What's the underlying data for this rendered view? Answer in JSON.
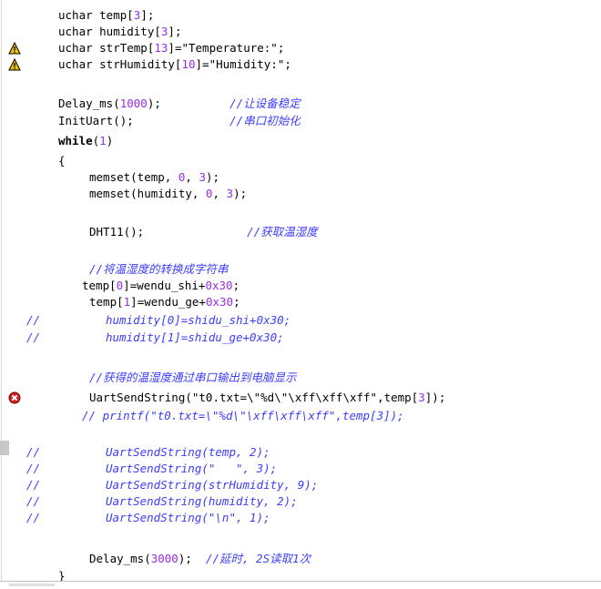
{
  "editor": {
    "lines": [
      {
        "indent": 64,
        "segments": [
          {
            "t": "uchar temp[",
            "c": "plain"
          },
          {
            "t": "3",
            "c": "num"
          },
          {
            "t": "];",
            "c": "plain"
          }
        ]
      },
      {
        "indent": 64,
        "segments": [
          {
            "t": "uchar humidity[",
            "c": "plain"
          },
          {
            "t": "3",
            "c": "num"
          },
          {
            "t": "];",
            "c": "plain"
          }
        ]
      },
      {
        "indent": 64,
        "marker": "warning",
        "segments": [
          {
            "t": "uchar strTemp[",
            "c": "plain"
          },
          {
            "t": "13",
            "c": "num"
          },
          {
            "t": "]=\"Temperature:\";",
            "c": "plain"
          }
        ]
      },
      {
        "indent": 64,
        "marker": "warning",
        "segments": [
          {
            "t": "uchar strHumidity[",
            "c": "plain"
          },
          {
            "t": "10",
            "c": "num"
          },
          {
            "t": "]=\"Humidity:\";",
            "c": "plain"
          }
        ]
      },
      {
        "indent": 64,
        "segments": []
      },
      {
        "indent": 64,
        "segments": [
          {
            "t": "Delay_ms(",
            "c": "plain"
          },
          {
            "t": "1000",
            "c": "num"
          },
          {
            "t": ");          ",
            "c": "plain"
          },
          {
            "t": "//让设备稳定",
            "c": "cm"
          }
        ]
      },
      {
        "indent": 64,
        "segments": [
          {
            "t": "InitUart();              ",
            "c": "plain"
          },
          {
            "t": "//串口初始化",
            "c": "cm"
          }
        ]
      },
      {
        "indent": 64,
        "segments": [
          {
            "t": "while",
            "c": "kw"
          },
          {
            "t": "(",
            "c": "plain"
          },
          {
            "t": "1",
            "c": "num"
          },
          {
            "t": ")",
            "c": "plain"
          }
        ]
      },
      {
        "indent": 64,
        "segments": [
          {
            "t": "{",
            "c": "plain"
          }
        ]
      },
      {
        "indent": 98,
        "segments": [
          {
            "t": "memset(temp, ",
            "c": "plain"
          },
          {
            "t": "0",
            "c": "num"
          },
          {
            "t": ", ",
            "c": "plain"
          },
          {
            "t": "3",
            "c": "num"
          },
          {
            "t": ");",
            "c": "plain"
          }
        ]
      },
      {
        "indent": 98,
        "segments": [
          {
            "t": "memset(humidity, ",
            "c": "plain"
          },
          {
            "t": "0",
            "c": "num"
          },
          {
            "t": ", ",
            "c": "plain"
          },
          {
            "t": "3",
            "c": "num"
          },
          {
            "t": ");",
            "c": "plain"
          }
        ]
      },
      {
        "indent": 98,
        "segments": []
      },
      {
        "indent": 98,
        "segments": [
          {
            "t": "DHT11();               ",
            "c": "plain"
          },
          {
            "t": "//获取温湿度",
            "c": "cm"
          }
        ]
      },
      {
        "indent": 98,
        "segments": []
      },
      {
        "indent": 98,
        "segments": [
          {
            "t": "//将温湿度的转换成字符串",
            "c": "cm"
          }
        ]
      },
      {
        "indent": 90,
        "segments": [
          {
            "t": "temp[",
            "c": "plain"
          },
          {
            "t": "0",
            "c": "num"
          },
          {
            "t": "]=wendu_shi+",
            "c": "plain"
          },
          {
            "t": "0x30",
            "c": "num"
          },
          {
            "t": ";",
            "c": "plain"
          }
        ]
      },
      {
        "indent": 98,
        "segments": [
          {
            "t": "temp[",
            "c": "plain"
          },
          {
            "t": "1",
            "c": "num"
          },
          {
            "t": "]=wendu_ge+",
            "c": "plain"
          },
          {
            "t": "0x30",
            "c": "num"
          },
          {
            "t": ";",
            "c": "plain"
          }
        ]
      },
      {
        "indent": 116,
        "comment_mark": "//",
        "segments": [
          {
            "t": "humidity[0]=shidu_shi+0x30;",
            "c": "dis"
          }
        ]
      },
      {
        "indent": 116,
        "comment_mark": "//",
        "segments": [
          {
            "t": "humidity[1]=shidu_ge+0x30;",
            "c": "dis"
          }
        ]
      },
      {
        "indent": 98,
        "segments": []
      },
      {
        "indent": 98,
        "segments": [
          {
            "t": "//获得的温湿度通过串口输出到电脑显示",
            "c": "cm"
          }
        ]
      },
      {
        "indent": 98,
        "marker": "error",
        "segments": [
          {
            "t": "UartSendString(\"t0.txt=\\\"%d\\\"\\xff\\xff\\xff\",temp[",
            "c": "plain"
          },
          {
            "t": "3",
            "c": "num"
          },
          {
            "t": "]);",
            "c": "plain"
          }
        ]
      },
      {
        "indent": 90,
        "segments": [
          {
            "t": "// printf(\"t0.txt=\\\"%d\\\"\\xff\\xff\\xff\",temp[3]);",
            "c": "dis"
          }
        ]
      },
      {
        "indent": 98,
        "segments": []
      },
      {
        "indent": 116,
        "comment_mark": "//",
        "segments": [
          {
            "t": "UartSendString(temp, 2);",
            "c": "dis"
          }
        ]
      },
      {
        "indent": 116,
        "comment_mark": "//",
        "segments": [
          {
            "t": "UartSendString(\"   \", 3);",
            "c": "dis"
          }
        ]
      },
      {
        "indent": 116,
        "comment_mark": "//",
        "segments": [
          {
            "t": "UartSendString(strHumidity, 9);",
            "c": "dis"
          }
        ]
      },
      {
        "indent": 116,
        "comment_mark": "//",
        "segments": [
          {
            "t": "UartSendString(humidity, 2);",
            "c": "dis"
          }
        ]
      },
      {
        "indent": 116,
        "comment_mark": "//",
        "segments": [
          {
            "t": "UartSendString(\"\\n\", 1);",
            "c": "dis"
          }
        ]
      },
      {
        "indent": 98,
        "segments": []
      },
      {
        "indent": 98,
        "segments": [
          {
            "t": "Delay_ms(",
            "c": "plain"
          },
          {
            "t": "3000",
            "c": "num"
          },
          {
            "t": ");  ",
            "c": "plain"
          },
          {
            "t": "//延时, 2S读取1次",
            "c": "cm"
          }
        ]
      },
      {
        "indent": 64,
        "segments": [
          {
            "t": "}",
            "c": "plain"
          }
        ]
      }
    ]
  },
  "colors": {
    "keyword": "#000000",
    "number": "#9a2de6",
    "comment": "#3c3cff",
    "warning": "#f0c000",
    "error": "#d02020"
  },
  "icons": {
    "warning": "warning-icon",
    "error": "error-icon"
  }
}
